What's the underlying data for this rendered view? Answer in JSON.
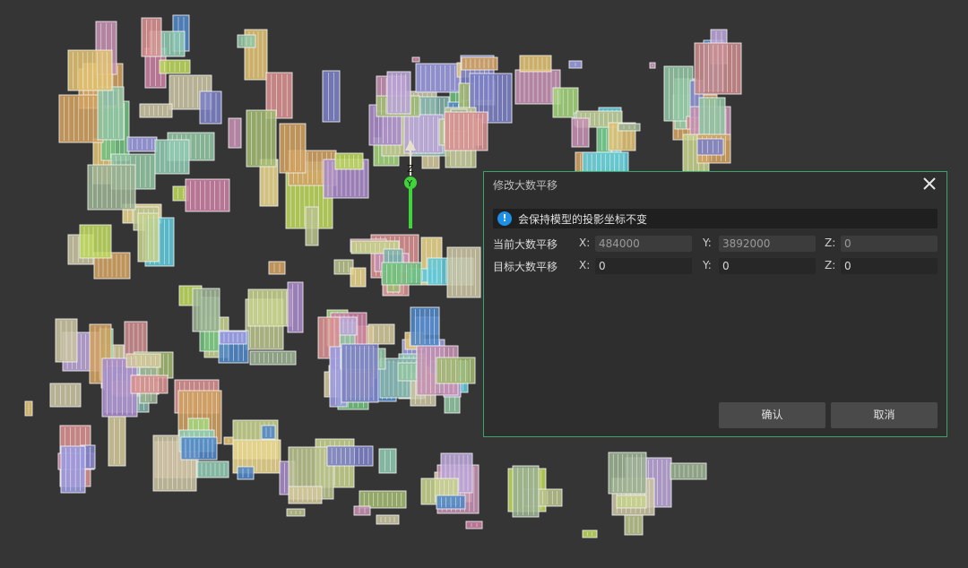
{
  "dialog": {
    "title": "修改大数平移",
    "info": "会保持模型的投影坐标不变",
    "current": {
      "label": "当前大数平移",
      "x_label": "X:",
      "y_label": "Y:",
      "z_label": "Z:",
      "x": "484000",
      "y": "3892000",
      "z": "0"
    },
    "target": {
      "label": "目标大数平移",
      "x_label": "X:",
      "y_label": "Y:",
      "z_label": "Z:",
      "x": "0",
      "y": "0",
      "z": "0"
    },
    "confirm": "确认",
    "cancel": "取消"
  },
  "gizmo": {
    "z_label": "Z",
    "y_label": "Y"
  },
  "colors": {
    "accent_border": "#3ea36a",
    "info_blue": "#1e8fe6",
    "gizmo_green": "#41d33b",
    "background": "#353535"
  }
}
